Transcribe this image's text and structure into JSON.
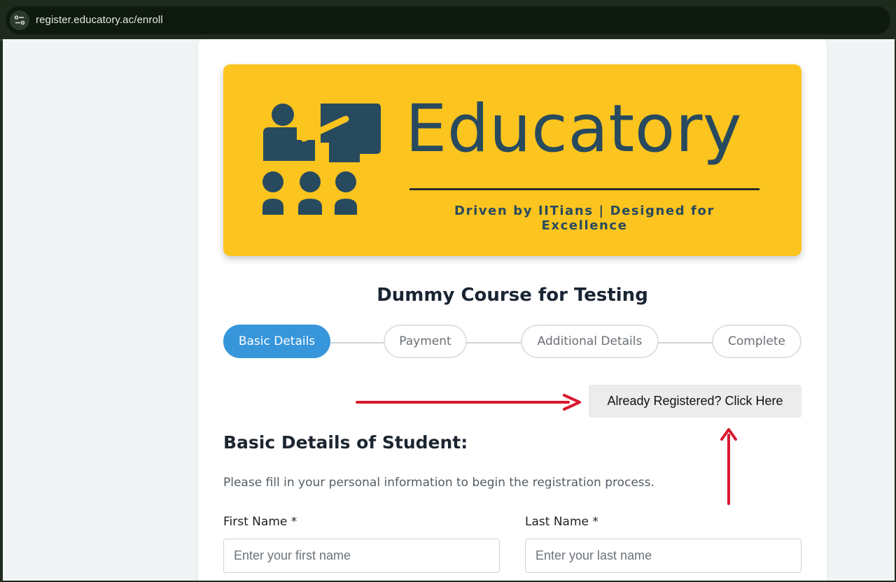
{
  "browser": {
    "url": "register.educatory.ac/enroll",
    "site_icon": "tune-icon"
  },
  "banner": {
    "logo_text": "Educatory",
    "tagline": "Driven by IITians | Designed for Excellence",
    "background_color": "#fcc41e",
    "brand_color": "#284a5e"
  },
  "course": {
    "title": "Dummy Course for Testing"
  },
  "steps": [
    {
      "label": "Basic Details",
      "active": true
    },
    {
      "label": "Payment",
      "active": false
    },
    {
      "label": "Additional Details",
      "active": false
    },
    {
      "label": "Complete",
      "active": false
    }
  ],
  "already_registered": {
    "label": "Already Registered? Click Here"
  },
  "form": {
    "heading": "Basic Details of Student:",
    "description": "Please fill in your personal information to begin the registration process.",
    "first_name": {
      "label": "First Name *",
      "placeholder": "Enter your first name",
      "value": ""
    },
    "last_name": {
      "label": "Last Name *",
      "placeholder": "Enter your last name",
      "value": ""
    }
  },
  "colors": {
    "accent": "#3796da",
    "annotation_arrow": "#d8182f"
  }
}
